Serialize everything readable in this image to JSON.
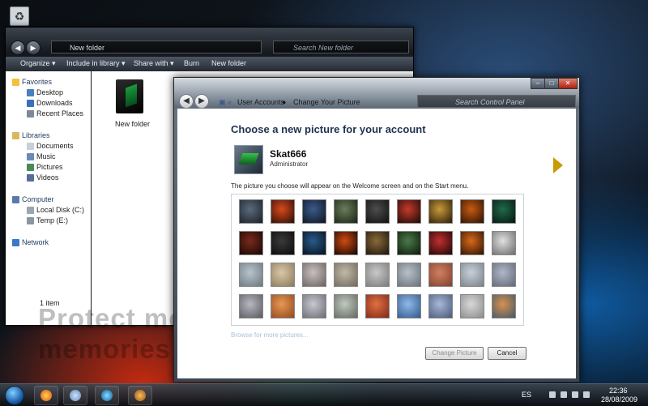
{
  "desktop": {
    "icon_label": "Recycle Bin"
  },
  "explorer": {
    "address": "New folder",
    "search_placeholder": "Search New folder",
    "toolbar": [
      "Organize ▾",
      "Include in library ▾",
      "Share with ▾",
      "Burn",
      "New folder"
    ],
    "favorites": {
      "label": "Favorites",
      "items": [
        "Desktop",
        "Downloads",
        "Recent Places"
      ]
    },
    "libraries": {
      "label": "Libraries",
      "items": [
        "Documents",
        "Music",
        "Pictures",
        "Videos"
      ]
    },
    "computer": {
      "label": "Computer",
      "items": [
        "Local Disk (C:)",
        "Temp (E:)"
      ]
    },
    "network": {
      "label": "Network"
    },
    "folder_name": "New folder",
    "status": "1 item"
  },
  "watermark": "Protect more of your memories",
  "control_panel": {
    "breadcrumb": [
      "User Accounts",
      "Change Your Picture"
    ],
    "search_placeholder": "Search Control Panel",
    "heading": "Choose a new picture for your account",
    "user": {
      "name": "Skat666",
      "role": "Administrator"
    },
    "description": "The picture you choose will appear on the Welcome screen and on the Start menu.",
    "browse_link": "Browse for more pictures...",
    "change_button": "Change Picture",
    "cancel_button": "Cancel"
  },
  "picture_tiles": [
    {
      "c1": "#5b6a7a",
      "c2": "#1a2028"
    },
    {
      "c1": "#d64a1c",
      "c2": "#2a0c06"
    },
    {
      "c1": "#3b5b8a",
      "c2": "#0d1422"
    },
    {
      "c1": "#6a7d5a",
      "c2": "#1a2214"
    },
    {
      "c1": "#4d4d4d",
      "c2": "#0f0f0f"
    },
    {
      "c1": "#c43a2a",
      "c2": "#1a0808"
    },
    {
      "c1": "#c89a3a",
      "c2": "#2a1a06"
    },
    {
      "c1": "#c65c12",
      "c2": "#2a0e02"
    },
    {
      "c1": "#1f6a4a",
      "c2": "#05150f"
    },
    {
      "c1": "#7a2a1a",
      "c2": "#140606"
    },
    {
      "c1": "#3a3a3a",
      "c2": "#0a0a0a"
    },
    {
      "c1": "#2a5a8a",
      "c2": "#05101c"
    },
    {
      "c1": "#d04a12",
      "c2": "#0f0502"
    },
    {
      "c1": "#8a6a3a",
      "c2": "#1c140a"
    },
    {
      "c1": "#4a7a4a",
      "c2": "#0c180c"
    },
    {
      "c1": "#c03030",
      "c2": "#1c0505"
    },
    {
      "c1": "#d86a1a",
      "c2": "#2a1004"
    },
    {
      "c1": "#e0e0e0",
      "c2": "#6a6a6a"
    },
    {
      "c1": "#b8c4cc",
      "c2": "#6c7880"
    },
    {
      "c1": "#d8c8a8",
      "c2": "#8a7a5a"
    },
    {
      "c1": "#c8c0c0",
      "c2": "#6a6060"
    },
    {
      "c1": "#c0b8a8",
      "c2": "#70685a"
    },
    {
      "c1": "#c8c8c8",
      "c2": "#7a7a7a"
    },
    {
      "c1": "#b8c0c8",
      "c2": "#68707a"
    },
    {
      "c1": "#d08060",
      "c2": "#804030"
    },
    {
      "c1": "#c8d0d8",
      "c2": "#78808a"
    },
    {
      "c1": "#b0b8c8",
      "c2": "#606878"
    },
    {
      "c1": "#b8b8c0",
      "c2": "#585860"
    },
    {
      "c1": "#e89850",
      "c2": "#904820"
    },
    {
      "c1": "#c8c8d0",
      "c2": "#6a6a72"
    },
    {
      "c1": "#c0c8c0",
      "c2": "#606860"
    },
    {
      "c1": "#e07040",
      "c2": "#802818"
    },
    {
      "c1": "#90b8e8",
      "c2": "#305888"
    },
    {
      "c1": "#a8b8d8",
      "c2": "#485878"
    },
    {
      "c1": "#d8d8d8",
      "c2": "#8a8a8a"
    },
    {
      "c1": "#d89050",
      "c2": "#405868"
    }
  ],
  "taskbar": {
    "language": "ES",
    "time": "22:36",
    "date": "28/08/2009"
  },
  "colors": {
    "heading": "#1e3250",
    "link": "#a9c0dc",
    "taskbar": "#1a2028"
  }
}
